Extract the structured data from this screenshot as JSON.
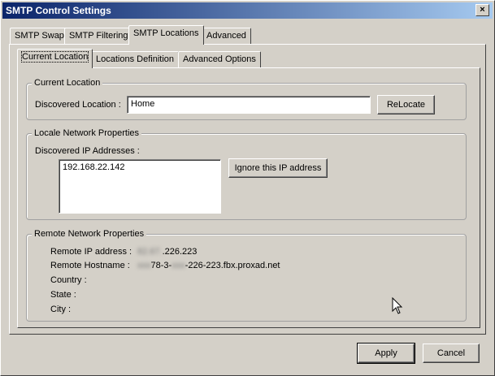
{
  "window": {
    "title": "SMTP Control Settings",
    "close_glyph": "×"
  },
  "main_tabs": [
    {
      "label": "SMTP Swap"
    },
    {
      "label": "SMTP Filtering"
    },
    {
      "label": "SMTP Locations"
    },
    {
      "label": "Advanced"
    }
  ],
  "sub_tabs": [
    {
      "label": "Current Location"
    },
    {
      "label": "Locations Definition"
    },
    {
      "label": "Advanced Options"
    }
  ],
  "current_location": {
    "legend": "Current Location",
    "discovered_label": "Discovered Location :",
    "discovered_value": "Home",
    "relocate_label": "ReLocate"
  },
  "locale_network": {
    "legend": "Locale Network Properties",
    "ips_label": "Discovered IP Addresses :",
    "ips": [
      "192.168.22.142"
    ],
    "ignore_label": "Ignore this IP address"
  },
  "remote_network": {
    "legend": "Remote Network Properties",
    "ip_label": "Remote IP address :",
    "ip_blurred": "82.67.",
    "ip_visible": ".226.223",
    "hostname_label": "Remote Hostname :",
    "hostname_blur_a": "xxx",
    "hostname_mid": "78-3-",
    "hostname_blur_b": "xxx",
    "hostname_visible": "-226-223.fbx.proxad.net",
    "country_label": "Country :",
    "state_label": "State :",
    "city_label": "City :"
  },
  "footer": {
    "apply_label": "Apply",
    "cancel_label": "Cancel"
  }
}
